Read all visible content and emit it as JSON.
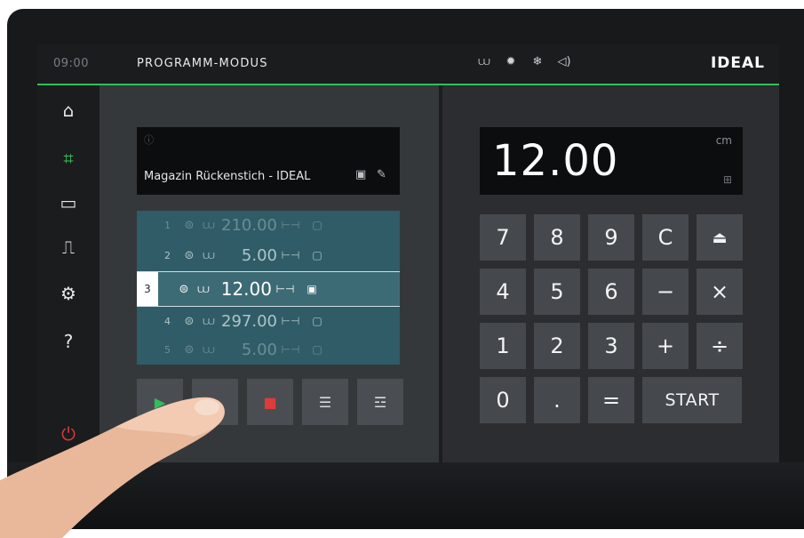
{
  "topbar": {
    "time": "09:00",
    "mode": "PROGRAMM-MODUS",
    "status_icons": [
      "stack-icon",
      "light-icon",
      "snowflake-icon",
      "sound-icon"
    ],
    "brand": "IDEAL",
    "accent_color": "#2fbf5a"
  },
  "sidebar": {
    "items": [
      {
        "name": "home",
        "icon": "home-icon",
        "glyph": "⌂"
      },
      {
        "name": "program-mode",
        "icon": "crop-icon",
        "glyph": "⌗",
        "active": true
      },
      {
        "name": "folder",
        "icon": "folder-icon",
        "glyph": "▭"
      },
      {
        "name": "door",
        "icon": "door-icon",
        "glyph": "⎍"
      },
      {
        "name": "settings",
        "icon": "gear-icon",
        "glyph": "⚙"
      },
      {
        "name": "help",
        "icon": "help-icon",
        "glyph": "?"
      },
      {
        "name": "power",
        "icon": "power-icon",
        "glyph": "⏻"
      }
    ]
  },
  "program": {
    "info_icon": "ⓘ",
    "name": "Magazin Rückenstich - IDEAL",
    "save_icon": "▣",
    "edit_icon": "✎"
  },
  "steps": [
    {
      "num": "1",
      "value": "210.00"
    },
    {
      "num": "2",
      "value": "5.00"
    },
    {
      "num": "3",
      "value": "12.00",
      "selected": true
    },
    {
      "num": "4",
      "value": "297.00"
    },
    {
      "num": "5",
      "value": "5.00"
    }
  ],
  "controls": [
    {
      "name": "play",
      "glyph": "▶"
    },
    {
      "name": "pause",
      "glyph": ""
    },
    {
      "name": "stop",
      "glyph": "■"
    },
    {
      "name": "insert-step",
      "glyph": "☰"
    },
    {
      "name": "delete-step",
      "glyph": "☲"
    }
  ],
  "display": {
    "value": "12.00",
    "unit": "cm",
    "mode_icon": "⊞"
  },
  "keypad": {
    "rows": [
      [
        "7",
        "8",
        "9",
        "C",
        "⏏"
      ],
      [
        "4",
        "5",
        "6",
        "−",
        "×"
      ],
      [
        "1",
        "2",
        "3",
        "+",
        "÷"
      ],
      [
        "0",
        ".",
        "=",
        "START"
      ]
    ]
  }
}
